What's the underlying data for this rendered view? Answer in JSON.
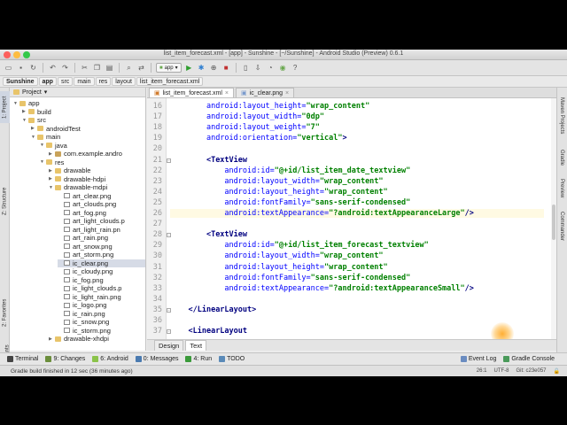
{
  "window": {
    "title": "list_item_forecast.xml - [app] - Sunshine - [~/Sunshine] - Android Studio (Preview) 0.6.1"
  },
  "toolbar": {
    "run_config": "app"
  },
  "breadcrumbs": [
    "Sunshine",
    "app",
    "src",
    "main",
    "res",
    "layout",
    "list_item_forecast.xml"
  ],
  "left_tabs": [
    "1: Project",
    "Z: Structure",
    "2: Favorites",
    "Build Variants"
  ],
  "right_tabs": [
    "Maven Projects",
    "Gradle",
    "Preview",
    "Commander"
  ],
  "project": {
    "header": "Project",
    "tree": [
      {
        "label": "app",
        "kind": "folder",
        "depth": 0,
        "expanded": true
      },
      {
        "label": "build",
        "kind": "folder",
        "depth": 1,
        "expanded": false
      },
      {
        "label": "src",
        "kind": "folder",
        "depth": 1,
        "expanded": true
      },
      {
        "label": "androidTest",
        "kind": "folder",
        "depth": 2,
        "expanded": false
      },
      {
        "label": "main",
        "kind": "folder",
        "depth": 2,
        "expanded": true
      },
      {
        "label": "java",
        "kind": "folder",
        "depth": 3,
        "expanded": true
      },
      {
        "label": "com.example.andro",
        "kind": "pkg",
        "depth": 4,
        "expanded": false
      },
      {
        "label": "res",
        "kind": "folder",
        "depth": 3,
        "expanded": true
      },
      {
        "label": "drawable",
        "kind": "folder",
        "depth": 4,
        "expanded": false
      },
      {
        "label": "drawable-hdpi",
        "kind": "folder",
        "depth": 4,
        "expanded": false
      },
      {
        "label": "drawable-mdpi",
        "kind": "folder",
        "depth": 4,
        "expanded": true
      },
      {
        "label": "art_clear.png",
        "kind": "file",
        "depth": 5
      },
      {
        "label": "art_clouds.png",
        "kind": "file",
        "depth": 5
      },
      {
        "label": "art_fog.png",
        "kind": "file",
        "depth": 5
      },
      {
        "label": "art_light_clouds.p",
        "kind": "file",
        "depth": 5
      },
      {
        "label": "art_light_rain.pn",
        "kind": "file",
        "depth": 5
      },
      {
        "label": "art_rain.png",
        "kind": "file",
        "depth": 5
      },
      {
        "label": "art_snow.png",
        "kind": "file",
        "depth": 5
      },
      {
        "label": "art_storm.png",
        "kind": "file",
        "depth": 5
      },
      {
        "label": "ic_clear.png",
        "kind": "file",
        "depth": 5,
        "selected": true
      },
      {
        "label": "ic_cloudy.png",
        "kind": "file",
        "depth": 5
      },
      {
        "label": "ic_fog.png",
        "kind": "file",
        "depth": 5
      },
      {
        "label": "ic_light_clouds.p",
        "kind": "file",
        "depth": 5
      },
      {
        "label": "ic_light_rain.png",
        "kind": "file",
        "depth": 5
      },
      {
        "label": "ic_logo.png",
        "kind": "file",
        "depth": 5
      },
      {
        "label": "ic_rain.png",
        "kind": "file",
        "depth": 5
      },
      {
        "label": "ic_snow.png",
        "kind": "file",
        "depth": 5
      },
      {
        "label": "ic_storm.png",
        "kind": "file",
        "depth": 5
      },
      {
        "label": "drawable-xhdpi",
        "kind": "folder",
        "depth": 4,
        "expanded": false
      }
    ]
  },
  "editor": {
    "tabs": [
      {
        "label": "list_item_forecast.xml",
        "active": true
      },
      {
        "label": "ic_clear.png",
        "active": false
      }
    ],
    "lines": [
      {
        "n": "16",
        "parts": [
          [
            "",
            "        "
          ],
          [
            "attr",
            "android:layout_height="
          ],
          [
            "val",
            "\"wrap_content\""
          ]
        ]
      },
      {
        "n": "17",
        "parts": [
          [
            "",
            "        "
          ],
          [
            "attr",
            "android:layout_width="
          ],
          [
            "val",
            "\"0dp\""
          ]
        ]
      },
      {
        "n": "18",
        "parts": [
          [
            "",
            "        "
          ],
          [
            "attr",
            "android:layout_weight="
          ],
          [
            "val",
            "\"7\""
          ]
        ]
      },
      {
        "n": "19",
        "parts": [
          [
            "",
            "        "
          ],
          [
            "attr",
            "android:orientation="
          ],
          [
            "val",
            "\"vertical\""
          ],
          [
            "tag",
            ">"
          ]
        ]
      },
      {
        "n": "20",
        "parts": [
          [
            "",
            ""
          ]
        ]
      },
      {
        "n": "21",
        "parts": [
          [
            "",
            "        "
          ],
          [
            "tag",
            "<TextView"
          ]
        ]
      },
      {
        "n": "22",
        "parts": [
          [
            "",
            "            "
          ],
          [
            "attr",
            "android:id="
          ],
          [
            "val",
            "\"@+id/list_item_date_textview\""
          ]
        ]
      },
      {
        "n": "23",
        "parts": [
          [
            "",
            "            "
          ],
          [
            "attr",
            "android:layout_width="
          ],
          [
            "val",
            "\"wrap_content\""
          ]
        ]
      },
      {
        "n": "24",
        "parts": [
          [
            "",
            "            "
          ],
          [
            "attr",
            "android:layout_height="
          ],
          [
            "val",
            "\"wrap_content\""
          ]
        ]
      },
      {
        "n": "25",
        "parts": [
          [
            "",
            "            "
          ],
          [
            "attr",
            "android:fontFamily="
          ],
          [
            "val",
            "\"sans-serif-condensed\""
          ]
        ]
      },
      {
        "n": "26",
        "parts": [
          [
            "",
            "            "
          ],
          [
            "attr",
            "android:textAppearance="
          ],
          [
            "val",
            "\"?android:textAppearanceLarge\""
          ],
          [
            "tag",
            "/>"
          ]
        ],
        "cursor": true
      },
      {
        "n": "27",
        "parts": [
          [
            "",
            ""
          ]
        ]
      },
      {
        "n": "28",
        "parts": [
          [
            "",
            "        "
          ],
          [
            "tag",
            "<TextView"
          ]
        ]
      },
      {
        "n": "29",
        "parts": [
          [
            "",
            "            "
          ],
          [
            "attr",
            "android:id="
          ],
          [
            "val",
            "\"@+id/list_item_forecast_textview\""
          ]
        ]
      },
      {
        "n": "30",
        "parts": [
          [
            "",
            "            "
          ],
          [
            "attr",
            "android:layout_width="
          ],
          [
            "val",
            "\"wrap_content\""
          ]
        ]
      },
      {
        "n": "31",
        "parts": [
          [
            "",
            "            "
          ],
          [
            "attr",
            "android:layout_height="
          ],
          [
            "val",
            "\"wrap_content\""
          ]
        ]
      },
      {
        "n": "32",
        "parts": [
          [
            "",
            "            "
          ],
          [
            "attr",
            "android:fontFamily="
          ],
          [
            "val",
            "\"sans-serif-condensed\""
          ]
        ]
      },
      {
        "n": "33",
        "parts": [
          [
            "",
            "            "
          ],
          [
            "attr",
            "android:textAppearance="
          ],
          [
            "val",
            "\"?android:textAppearanceSmall\""
          ],
          [
            "tag",
            "/>"
          ]
        ]
      },
      {
        "n": "34",
        "parts": [
          [
            "",
            ""
          ]
        ]
      },
      {
        "n": "35",
        "parts": [
          [
            "",
            "    "
          ],
          [
            "tag",
            "</LinearLayout>"
          ]
        ]
      },
      {
        "n": "36",
        "parts": [
          [
            "",
            ""
          ]
        ]
      },
      {
        "n": "37",
        "parts": [
          [
            "",
            "    "
          ],
          [
            "tag",
            "<LinearLayout"
          ]
        ]
      }
    ],
    "design_tabs": [
      {
        "label": "Design",
        "active": false
      },
      {
        "label": "Text",
        "active": true
      }
    ]
  },
  "tool_windows": [
    {
      "label": "Terminal",
      "color": "#444444"
    },
    {
      "label": "9: Changes",
      "color": "#6b8e3c"
    },
    {
      "label": "6: Android",
      "color": "#8bc34a"
    },
    {
      "label": "0: Messages",
      "color": "#4a7ab0"
    },
    {
      "label": "4: Run",
      "color": "#3a9a3a"
    },
    {
      "label": "TODO",
      "color": "#5a8ab8"
    }
  ],
  "tool_windows_right": [
    {
      "label": "Event Log",
      "color": "#6a8cc0"
    },
    {
      "label": "Gradle Console",
      "color": "#4a9a5a"
    }
  ],
  "status": {
    "message": "Gradle build finished in 12 sec (36 minutes ago)",
    "position": "26:1",
    "encoding": "UTF-8",
    "git": "Git: c23e057"
  }
}
